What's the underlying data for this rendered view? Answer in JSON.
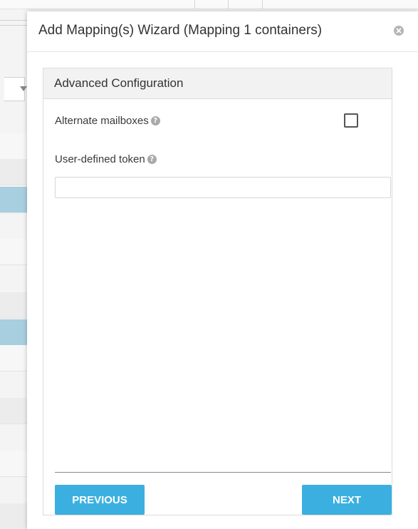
{
  "modal": {
    "title": "Add Mapping(s) Wizard (Mapping 1 containers)",
    "close_icon": "close-icon"
  },
  "panel": {
    "title": "Advanced Configuration",
    "fields": {
      "alternate_mailboxes": {
        "label": "Alternate mailboxes",
        "checked": false,
        "help_icon": "help-icon"
      },
      "user_defined_token": {
        "label": "User-defined token",
        "value": "",
        "help_icon": "help-icon"
      }
    }
  },
  "buttons": {
    "previous": "PREVIOUS",
    "next": "NEXT"
  },
  "colors": {
    "button": "#3bb0e0",
    "selected_row": "#a7cfe0"
  }
}
